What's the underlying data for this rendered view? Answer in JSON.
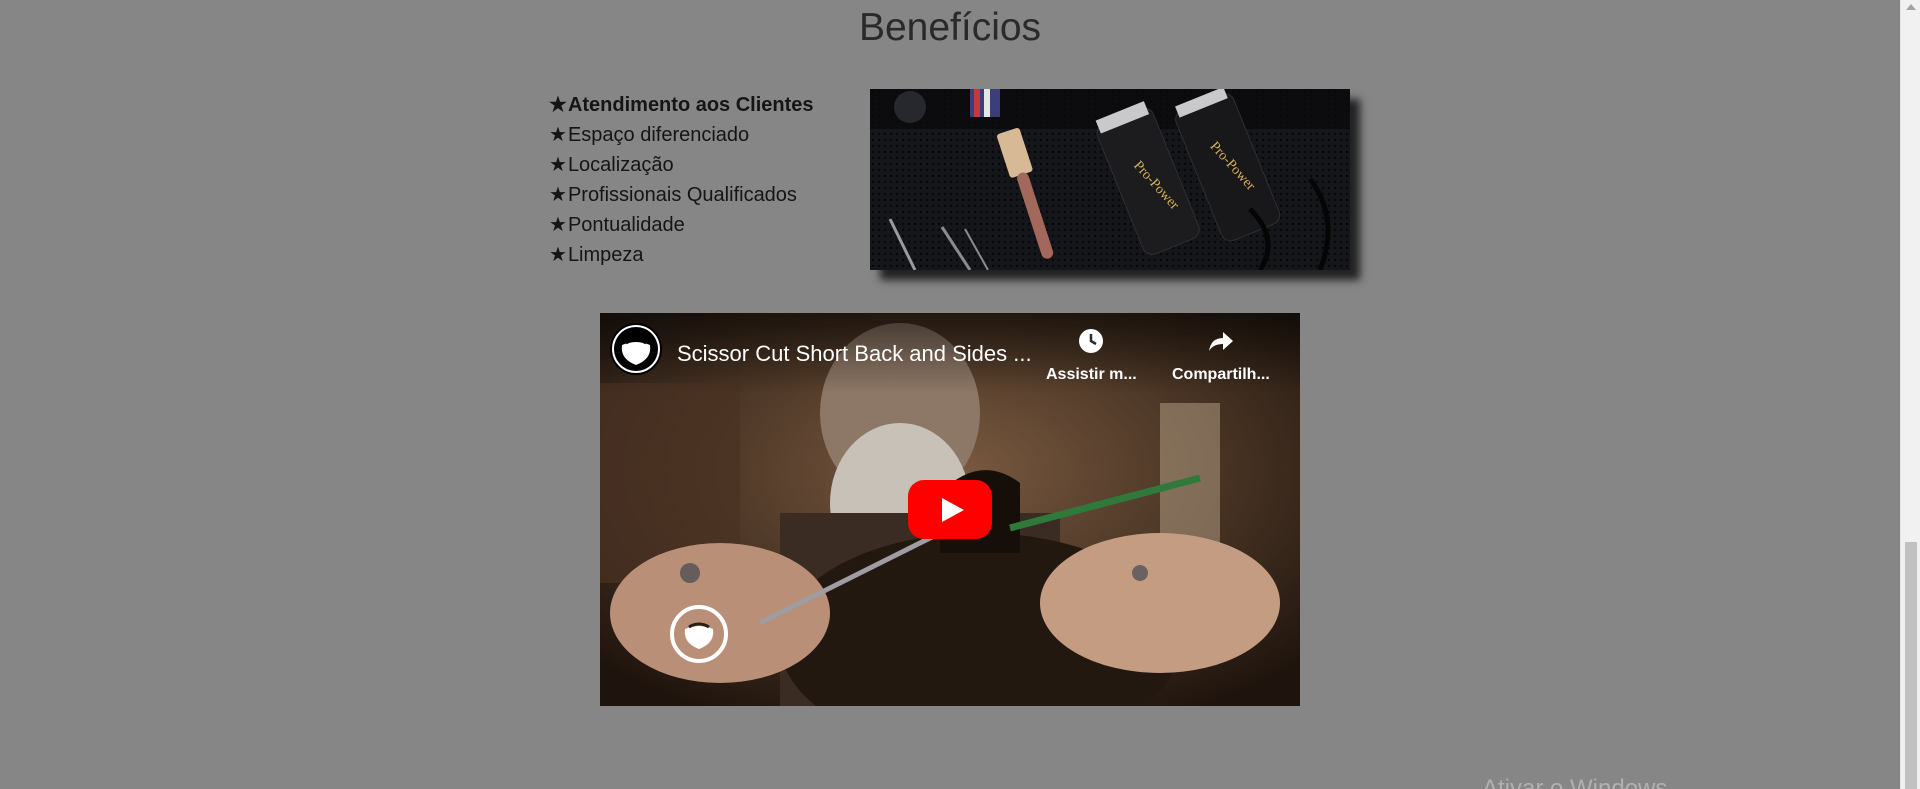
{
  "section": {
    "title": "Benefícios"
  },
  "benefits": {
    "items": [
      {
        "star": "★",
        "label": "Atendimento aos Clientes",
        "bold": true
      },
      {
        "star": "★",
        "label": "Espaço diferenciado"
      },
      {
        "star": "★",
        "label": "Localização"
      },
      {
        "star": "★",
        "label": "Profissionais Qualificados"
      },
      {
        "star": "★",
        "label": "Pontualidade"
      },
      {
        "star": "★",
        "label": "Limpeza"
      }
    ]
  },
  "video": {
    "title": "Scissor Cut Short Back and Sides ...",
    "watch_later_label": "Assistir m...",
    "share_label": "Compartilh...",
    "watch_later_icon": "clock-icon",
    "share_icon": "share-arrow-icon",
    "play_icon": "youtube-play-icon",
    "play_color": "#ff0000"
  },
  "os_overlay": {
    "text": "Ativar o Windows"
  },
  "colors": {
    "background": "#868686",
    "title_text": "#2a2a2a",
    "list_text": "#151515"
  }
}
